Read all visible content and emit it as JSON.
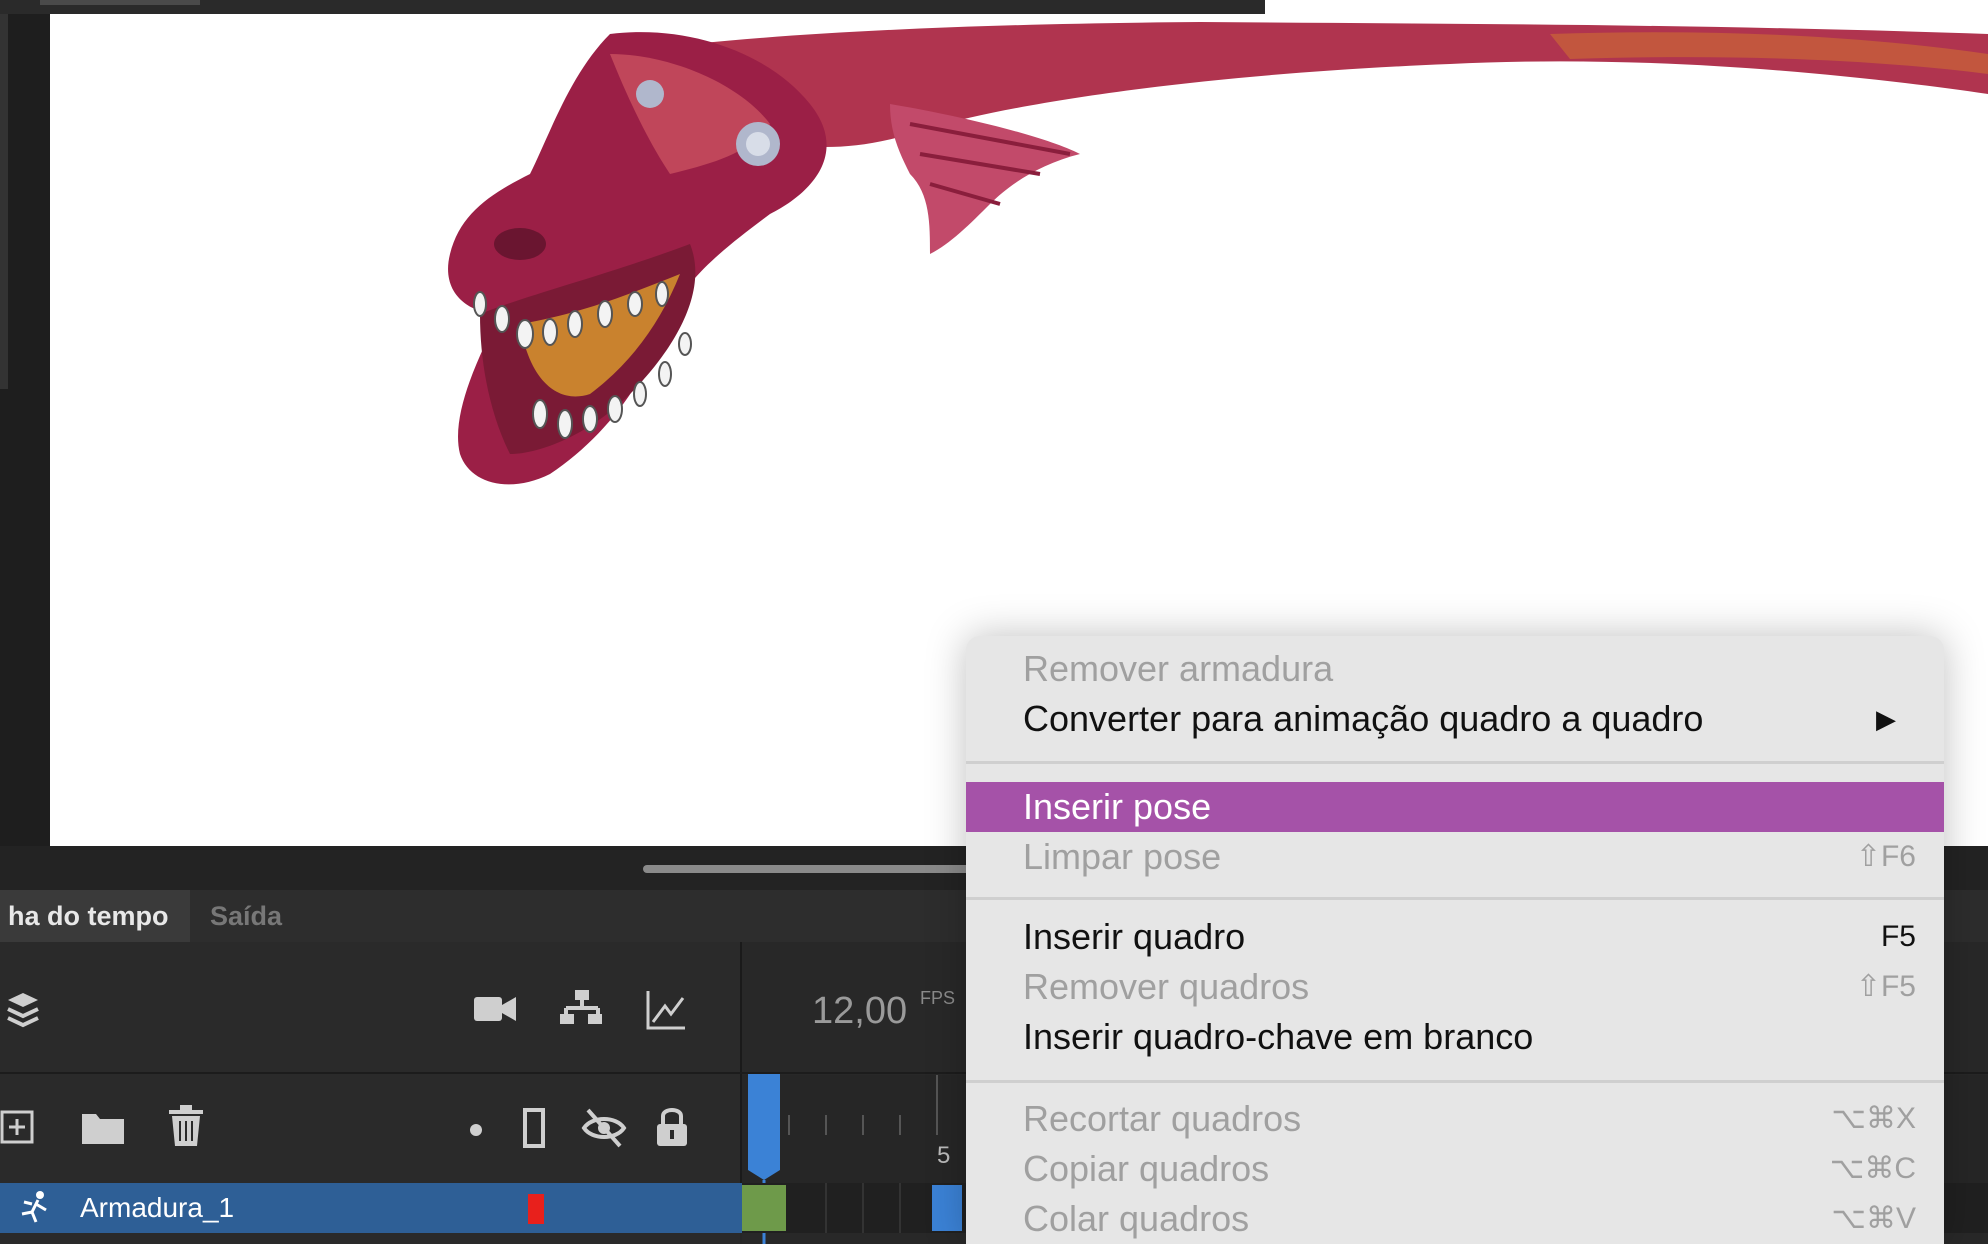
{
  "timeline": {
    "tab_active": "ha do tempo",
    "tab_output": "Saída",
    "fps_value": "12,00",
    "fps_unit": "FPS",
    "frame_number": "5",
    "layer_name": "Armadura_1"
  },
  "context_menu": {
    "items": [
      {
        "label": "Remover armadura",
        "shortcut": "",
        "enabled": false
      },
      {
        "label": "Converter para animação quadro a quadro",
        "shortcut": "",
        "enabled": true,
        "submenu": true
      },
      {
        "label": "Inserir pose",
        "shortcut": "",
        "enabled": true,
        "highlighted": true
      },
      {
        "label": "Limpar pose",
        "shortcut": "⇧F6",
        "enabled": false
      },
      {
        "label": "Inserir quadro",
        "shortcut": "F5",
        "enabled": true
      },
      {
        "label": "Remover quadros",
        "shortcut": "⇧F5",
        "enabled": false
      },
      {
        "label": "Inserir quadro-chave em branco",
        "shortcut": "",
        "enabled": true
      },
      {
        "label": "Recortar quadros",
        "shortcut": "⌥⌘X",
        "enabled": false
      },
      {
        "label": "Copiar quadros",
        "shortcut": "⌥⌘C",
        "enabled": false
      },
      {
        "label": "Colar quadros",
        "shortcut": "⌥⌘V",
        "enabled": false
      }
    ]
  },
  "colors": {
    "highlight": "#a552a8",
    "layer_selected": "#2e5f96",
    "playhead": "#3b82d6",
    "keyframe": "#6e9a4a"
  }
}
